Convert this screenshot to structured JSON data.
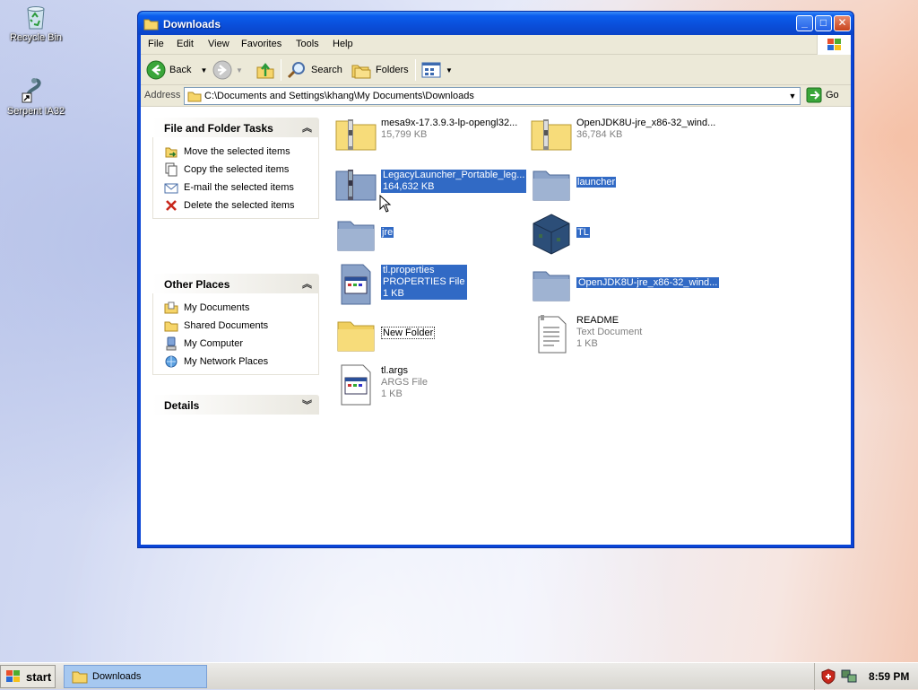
{
  "desktop": {
    "icons": [
      {
        "label": "Recycle Bin",
        "icon": "recycle-bin-icon"
      },
      {
        "label": "Serpent IA32",
        "icon": "serpent-shortcut-icon"
      }
    ]
  },
  "window": {
    "title": "Downloads",
    "menu": [
      "File",
      "Edit",
      "View",
      "Favorites",
      "Tools",
      "Help"
    ],
    "toolbar": {
      "back": "Back",
      "search": "Search",
      "folders": "Folders"
    },
    "address": {
      "label": "Address",
      "path": "C:\\Documents and Settings\\khang\\My Documents\\Downloads",
      "go": "Go"
    }
  },
  "sidebar": {
    "tasks": {
      "title": "File and Folder Tasks",
      "items": [
        "Move the selected items",
        "Copy the selected items",
        "E-mail the selected items",
        "Delete the selected items"
      ]
    },
    "places": {
      "title": "Other Places",
      "items": [
        "My Documents",
        "Shared Documents",
        "My Computer",
        "My Network Places"
      ]
    },
    "details": {
      "title": "Details"
    }
  },
  "files": [
    {
      "name": "mesa9x-17.3.9.3-lp-opengl32...",
      "line2": "15,799 KB",
      "line3": "",
      "type": "zip",
      "selected": false
    },
    {
      "name": "OpenJDK8U-jre_x86-32_wind...",
      "line2": "36,784 KB",
      "line3": "",
      "type": "zip",
      "selected": false
    },
    {
      "name": "LegacyLauncher_Portable_leg...",
      "line2": "164,632 KB",
      "line3": "",
      "type": "zip",
      "selected": true
    },
    {
      "name": "launcher",
      "line2": "",
      "line3": "",
      "type": "folder",
      "selected": true
    },
    {
      "name": "jre",
      "line2": "",
      "line3": "",
      "type": "folder",
      "selected": true
    },
    {
      "name": "TL",
      "line2": "",
      "line3": "",
      "type": "app",
      "selected": true
    },
    {
      "name": "tl.properties",
      "line2": "PROPERTIES File",
      "line3": "1 KB",
      "type": "properties",
      "selected": true
    },
    {
      "name": "OpenJDK8U-jre_x86-32_wind...",
      "line2": "",
      "line3": "",
      "type": "folder",
      "selected": true
    },
    {
      "name": "New Folder",
      "line2": "",
      "line3": "",
      "type": "folder-new",
      "selected": false
    },
    {
      "name": "README",
      "line2": "Text Document",
      "line3": "1 KB",
      "type": "text",
      "selected": false
    },
    {
      "name": "tl.args",
      "line2": "ARGS File",
      "line3": "1 KB",
      "type": "properties",
      "selected": false
    }
  ],
  "taskbar": {
    "start": "start",
    "task": "Downloads",
    "clock": "8:59 PM"
  }
}
